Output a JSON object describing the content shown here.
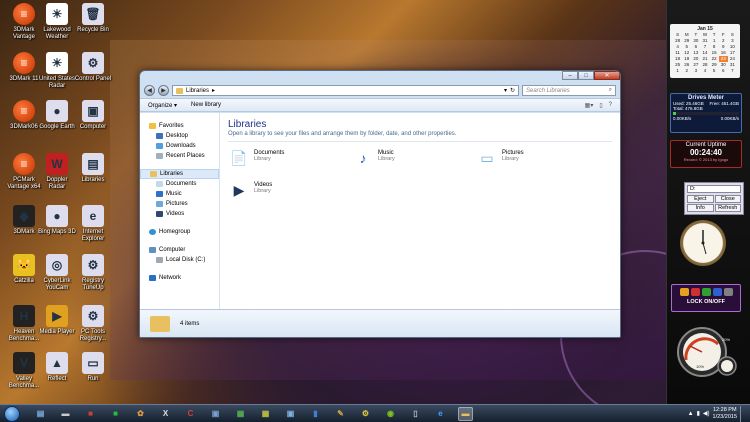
{
  "desktop_icons": [
    {
      "label": "3DMark Vantage",
      "icon": "3dmark-icon",
      "glyph": "≡"
    },
    {
      "label": "Lakewood Weather",
      "icon": "weather-icon",
      "glyph": "☀"
    },
    {
      "label": "Recycle Bin",
      "icon": "recycle-bin-icon",
      "glyph": "🗑"
    },
    {
      "label": "3DMark 11",
      "icon": "3dmark-icon",
      "glyph": "≡"
    },
    {
      "label": "United States Radar",
      "icon": "radar-icon",
      "glyph": "☀"
    },
    {
      "label": "Control Panel",
      "icon": "control-panel-icon",
      "glyph": "⚙"
    },
    {
      "label": "3DMark06",
      "icon": "3dmark-icon",
      "glyph": "≡"
    },
    {
      "label": "Google Earth",
      "icon": "google-earth-icon",
      "glyph": "●"
    },
    {
      "label": "Computer",
      "icon": "computer-icon",
      "glyph": "▣"
    },
    {
      "label": "PCMark Vantage x64",
      "icon": "pcmark-icon",
      "glyph": "≡"
    },
    {
      "label": "Doppler Radar",
      "icon": "doppler-icon",
      "glyph": "W"
    },
    {
      "label": "Libraries",
      "icon": "libraries-icon",
      "glyph": "▤"
    },
    {
      "label": "3DMark",
      "icon": "3dmark-icon",
      "glyph": "◆"
    },
    {
      "label": "Bing Maps 3D",
      "icon": "bing-maps-icon",
      "glyph": "●"
    },
    {
      "label": "Internet Explorer",
      "icon": "ie-icon",
      "glyph": "e"
    },
    {
      "label": "Catzilla",
      "icon": "catzilla-icon",
      "glyph": "🐱"
    },
    {
      "label": "CyberLink YouCam",
      "icon": "youcam-icon",
      "glyph": "◎"
    },
    {
      "label": "Registry TuneUp",
      "icon": "registry-icon",
      "glyph": "⚙"
    },
    {
      "label": "Heaven Benchma...",
      "icon": "heaven-icon",
      "glyph": "H"
    },
    {
      "label": "Media Player",
      "icon": "media-player-icon",
      "glyph": "▶"
    },
    {
      "label": "PC Tools Registry...",
      "icon": "pctools-icon",
      "glyph": "⚙"
    },
    {
      "label": "Valley Benchma...",
      "icon": "valley-icon",
      "glyph": "V"
    },
    {
      "label": "Reflect",
      "icon": "reflect-icon",
      "glyph": "▲"
    },
    {
      "label": "Run",
      "icon": "run-icon",
      "glyph": "▭"
    }
  ],
  "explorer": {
    "address_crumb": "Libraries",
    "search_placeholder": "Search Libraries",
    "organize_label": "Organize ▾",
    "new_library_label": "New library",
    "nav": {
      "favorites": "Favorites",
      "desktop": "Desktop",
      "downloads": "Downloads",
      "recent_places": "Recent Places",
      "libraries": "Libraries",
      "documents": "Documents",
      "music": "Music",
      "pictures": "Pictures",
      "videos": "Videos",
      "homegroup": "Homegroup",
      "computer": "Computer",
      "local_disk": "Local Disk (C:)",
      "network": "Network"
    },
    "heading": "Libraries",
    "subheading": "Open a library to see your files and arrange them by folder, date, and other properties.",
    "libraries": [
      {
        "name": "Documents",
        "type": "Library",
        "icon": "documents-library-icon",
        "glyph": "📄"
      },
      {
        "name": "Music",
        "type": "Library",
        "icon": "music-library-icon",
        "glyph": "♪"
      },
      {
        "name": "Pictures",
        "type": "Library",
        "icon": "pictures-library-icon",
        "glyph": "▭"
      },
      {
        "name": "Videos",
        "type": "Library",
        "icon": "videos-library-icon",
        "glyph": "▶"
      }
    ],
    "status": "4 items"
  },
  "gadgets": {
    "calendar": {
      "month": "Jan 15",
      "days": [
        "S",
        "M",
        "T",
        "W",
        "T",
        "F",
        "S"
      ],
      "weeks": [
        [
          "28",
          "29",
          "30",
          "31",
          "1",
          "2",
          "3"
        ],
        [
          "4",
          "5",
          "6",
          "7",
          "8",
          "9",
          "10"
        ],
        [
          "11",
          "12",
          "13",
          "14",
          "15",
          "16",
          "17"
        ],
        [
          "18",
          "19",
          "20",
          "21",
          "22",
          "23",
          "24"
        ],
        [
          "25",
          "26",
          "27",
          "28",
          "29",
          "30",
          "31"
        ],
        [
          "1",
          "2",
          "3",
          "4",
          "5",
          "6",
          "7"
        ]
      ],
      "today": "23"
    },
    "drives": {
      "title": "Drives Meter",
      "used": "Used: 25.46GB",
      "free": "Free: 451.4GB",
      "total": "Total: 476.8GB",
      "read": "0.00KB/s",
      "write": "0.00KB/s",
      "used_fraction": 0.05
    },
    "uptime": {
      "title": "Current Uptime",
      "value": "00:24:40",
      "record": "Record:",
      "copyright": "© 2013 by Igogo"
    },
    "eject": {
      "drive": "D:",
      "eject": "Eject",
      "close": "Close",
      "info": "Info",
      "refresh": "Refresh"
    },
    "lock": {
      "label": "LOCK ON/OFF"
    },
    "gauge": {
      "cpu": "10%",
      "ram": "20%"
    }
  },
  "taskbar": {
    "time": "12:28 PM",
    "date": "1/23/2015",
    "apps": [
      {
        "icon": "explorer-icon",
        "glyph": "▤",
        "color": "#7fb4e8"
      },
      {
        "icon": "printer-icon",
        "glyph": "▬",
        "color": "#ccc"
      },
      {
        "icon": "pdf-icon",
        "glyph": "■",
        "color": "#d04030"
      },
      {
        "icon": "app-green-icon",
        "glyph": "■",
        "color": "#20c040"
      },
      {
        "icon": "paint-icon",
        "glyph": "✿",
        "color": "#e0a040"
      },
      {
        "icon": "xtu-icon",
        "glyph": "X",
        "color": "#ddd"
      },
      {
        "icon": "ccleaner-icon",
        "glyph": "C",
        "color": "#d04030"
      },
      {
        "icon": "pc-icon",
        "glyph": "▣",
        "color": "#7aa0d0"
      },
      {
        "icon": "gpu-icon",
        "glyph": "▦",
        "color": "#50b050"
      },
      {
        "icon": "chip-icon",
        "glyph": "▦",
        "color": "#c0c040"
      },
      {
        "icon": "monitor-icon",
        "glyph": "▣",
        "color": "#80b0e0"
      },
      {
        "icon": "bars-icon",
        "glyph": "▮",
        "color": "#4080d0"
      },
      {
        "icon": "tools-icon",
        "glyph": "✎",
        "color": "#d0a040"
      },
      {
        "icon": "settings-icon",
        "glyph": "⚙",
        "color": "#e0d040"
      },
      {
        "icon": "nvidia-icon",
        "glyph": "◉",
        "color": "#80c020"
      },
      {
        "icon": "phone-icon",
        "glyph": "▯",
        "color": "#bbb"
      },
      {
        "icon": "ie-task-icon",
        "glyph": "e",
        "color": "#40a0ff"
      },
      {
        "icon": "folder-task-icon",
        "glyph": "▬",
        "color": "#e8c060",
        "active": true
      }
    ]
  }
}
